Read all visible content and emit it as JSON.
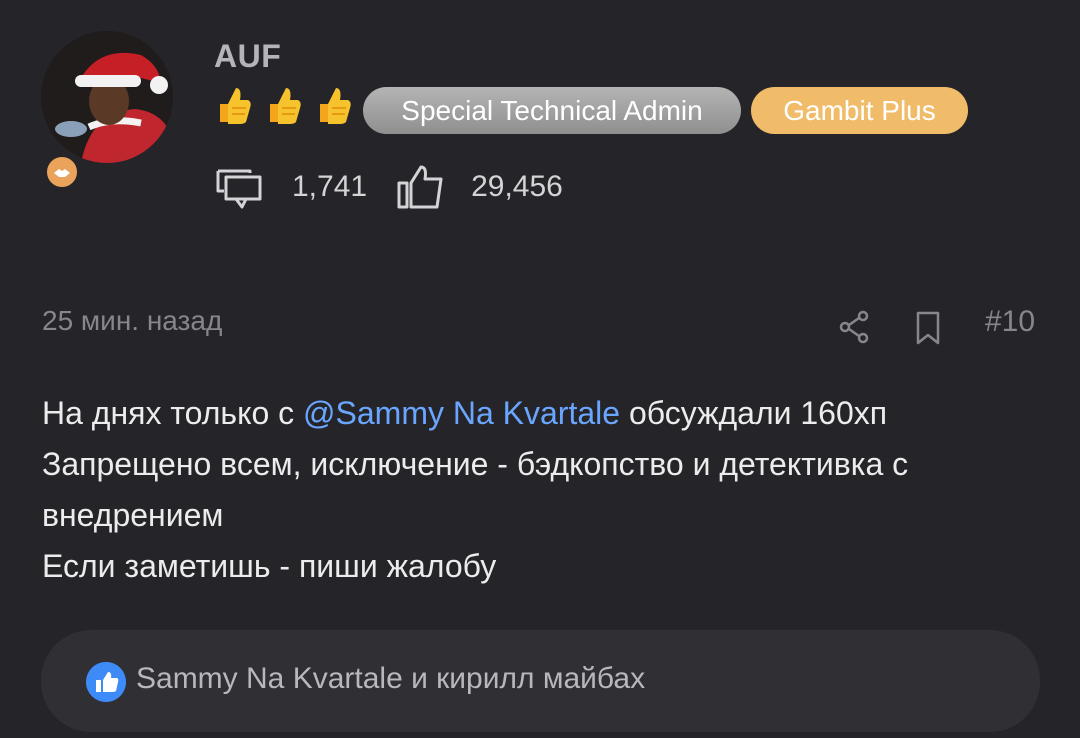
{
  "user": {
    "name": "AUF",
    "reactions": [
      "thumbs-up-emoji",
      "thumbs-up-emoji",
      "thumbs-up-emoji"
    ],
    "badges": {
      "admin": "Special Technical Admin",
      "plus": "Gambit Plus"
    },
    "stats": {
      "messages": "1,741",
      "likes": "29,456"
    }
  },
  "post": {
    "time": "25 мин. назад",
    "number": "#10",
    "line1_prefix": "На днях только с ",
    "mention": "@Sammy Na Kvartale",
    "line1_suffix": " обсуждали 160хп",
    "line2": "Запрещено всем, исключение - бэдкопство и детективка с",
    "line3": "внедрением",
    "line4": "Если заметишь - пиши жалобу"
  },
  "likes": {
    "text": "Sammy Na Kvartale и кирилл майбах"
  },
  "colors": {
    "background": "#252529",
    "mention": "#6aa6ff",
    "admin_badge": "#a3a3a3",
    "plus_badge": "#f0bc6a",
    "like_bubble": "#3e8af7"
  },
  "icons": {
    "messages": "message-icon",
    "likes": "thumbs-up-icon",
    "share": "share-icon",
    "bookmark": "bookmark-icon"
  }
}
